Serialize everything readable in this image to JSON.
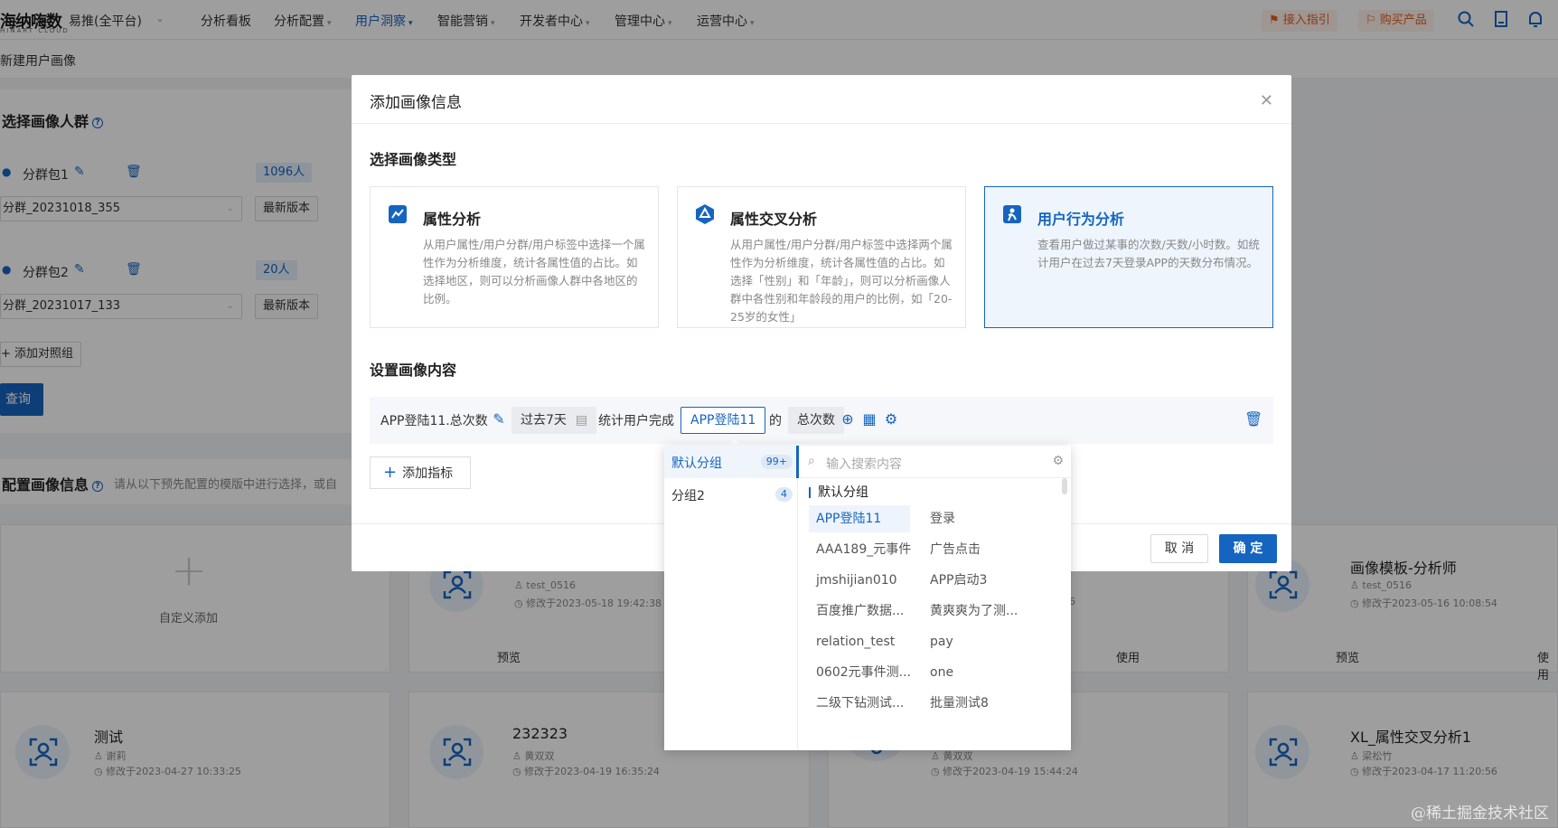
{
  "nav": {
    "logo": "海纳嗨数",
    "logo_sub": "HINART CLOUD",
    "platform": "易推(全平台)",
    "items": [
      {
        "label": "分析看板",
        "has_menu": false
      },
      {
        "label": "分析配置",
        "has_menu": true
      },
      {
        "label": "用户洞察",
        "has_menu": true,
        "active": true
      },
      {
        "label": "智能营销",
        "has_menu": true
      },
      {
        "label": "开发者中心",
        "has_menu": true
      },
      {
        "label": "管理中心",
        "has_menu": true
      },
      {
        "label": "运营中心",
        "has_menu": true
      }
    ],
    "guide_label": "接入指引",
    "buy_label": "购买产品"
  },
  "breadcrumb": "新建用户画像",
  "left": {
    "section_title": "选择画像人群",
    "groups": [
      {
        "label": "分群包1",
        "count": "1096人",
        "segment": "分群_20231018_355",
        "version": "最新版本"
      },
      {
        "label": "分群包2",
        "count": "20人",
        "segment": "分群_20231017_133",
        "version": "最新版本"
      }
    ],
    "add_compare": "添加对照组",
    "query": "查询",
    "config_title": "配置画像信息",
    "config_hint": "请从以下预先配置的模版中进行选择，或自"
  },
  "templates": {
    "custom_add": "自定义添加",
    "preview": "预览",
    "use": "使用",
    "cards": [
      {
        "title": "",
        "author": "test_0516",
        "modified": "修改于2023-05-18 19:42:38"
      },
      {
        "title": "画像模板-分析师",
        "author": "test_0516",
        "modified": "修改于2023-05-16 10:08:54"
      },
      {
        "title": "测试",
        "author": "谢莉",
        "modified": "修改于2023-04-27 10:33:25"
      },
      {
        "title": "232323",
        "author": "黄双双",
        "modified": "修改于2023-04-19 16:35:24"
      },
      {
        "title": "",
        "author": "黄双双",
        "modified": "修改于2023-04-19 15:44:24"
      },
      {
        "title": "XL_属性交叉分析1",
        "author": "梁松竹",
        "modified": "修改于2023-04-17 11:20:56"
      }
    ],
    "partial_number": "6"
  },
  "modal": {
    "title": "添加画像信息",
    "type_section": "选择画像类型",
    "types": [
      {
        "title": "属性分析",
        "desc": "从用户属性/用户分群/用户标签中选择一个属性作为分析维度，统计各属性值的占比。如选择地区，则可以分析画像人群中各地区的比例。",
        "selected": false
      },
      {
        "title": "属性交叉分析",
        "desc": "从用户属性/用户分群/用户标签中选择两个属性作为分析维度，统计各属性值的占比。如选择「性别」和「年龄」，则可以分析画像人群中各性别和年龄段的用户的比例，如「20-25岁的女性」",
        "selected": false
      },
      {
        "title": "用户行为分析",
        "desc": "查看用户做过某事的次数/天数/小时数。如统计用户在过去7天登录APP的天数分布情况。",
        "selected": true
      }
    ],
    "content_section": "设置画像内容",
    "metric": {
      "name": "APP登陆11.总次数",
      "time_range": "过去7天",
      "stat_prefix": "统计用户完成",
      "event": "APP登陆11",
      "of": "的",
      "measure": "总次数"
    },
    "add_metric": "添加指标",
    "cancel": "取 消",
    "ok": "确 定"
  },
  "dropdown": {
    "groups": [
      {
        "label": "默认分组",
        "badge": "99+",
        "active": true
      },
      {
        "label": "分组2",
        "badge": "4",
        "active": false
      }
    ],
    "search_placeholder": "输入搜索内容",
    "group_head": "默认分组",
    "items": [
      [
        "APP登陆11",
        "登录"
      ],
      [
        "AAA189_元事件",
        "广告点击"
      ],
      [
        "jmshijian010",
        "APP启动3"
      ],
      [
        "百度推广数据...",
        "黄爽爽为了测..."
      ],
      [
        "relation_test",
        "pay"
      ],
      [
        "0602元事件测...",
        "one"
      ],
      [
        "二级下钻测试...",
        "批量测试8"
      ]
    ],
    "selected": "APP登陆11"
  },
  "watermark": "@稀土掘金技术社区",
  "colors": {
    "accent": "#1565c0",
    "warn": "#e25d1d"
  }
}
